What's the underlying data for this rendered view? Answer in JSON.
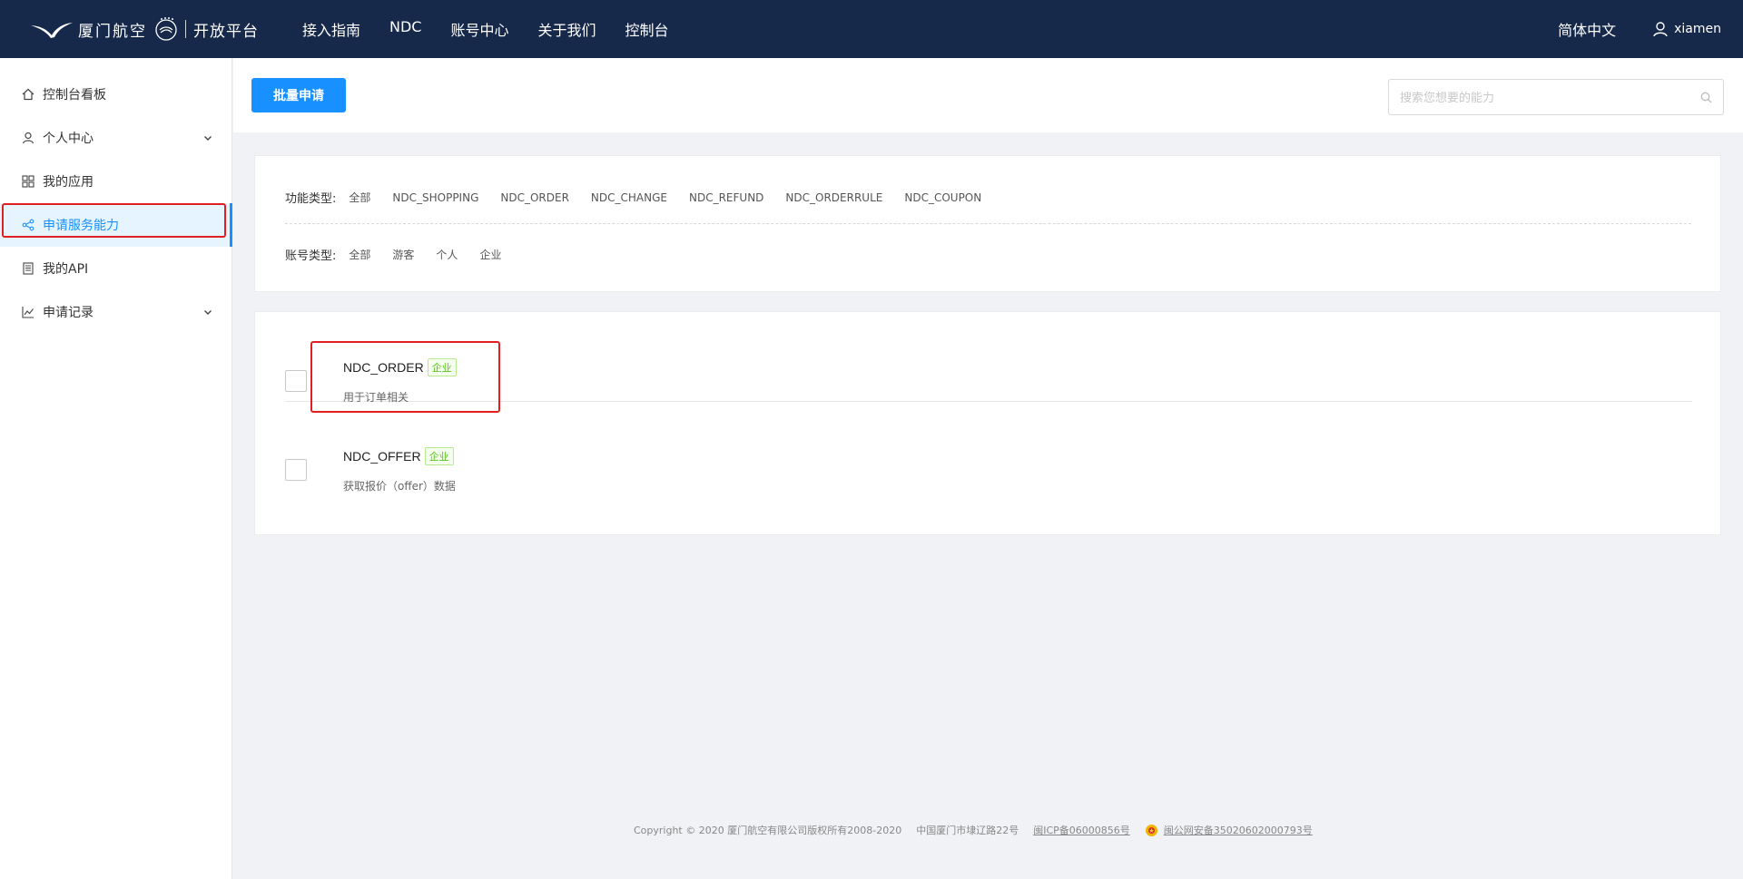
{
  "header": {
    "logo_cn": "厦门航空",
    "logo_platform": "开放平台",
    "nav": [
      "接入指南",
      "NDC",
      "账号中心",
      "关于我们",
      "控制台"
    ],
    "language": "简体中文",
    "username": "xiamen",
    "bg_color": "#17294a"
  },
  "sidebar": {
    "items": [
      {
        "label": "控制台看板",
        "icon": "home-icon"
      },
      {
        "label": "个人中心",
        "icon": "user-icon"
      },
      {
        "label": "我的应用",
        "icon": "apps-grid-icon"
      },
      {
        "label": "申请服务能力",
        "icon": "share-icon"
      },
      {
        "label": "我的API",
        "icon": "document-icon"
      },
      {
        "label": "申请记录",
        "icon": "chart-line-icon"
      }
    ],
    "active_index": 3,
    "accent": "#1890ff"
  },
  "toolbar": {
    "batch_button": "批量申请",
    "search_placeholder": "搜索您想要的能力"
  },
  "filters": {
    "func_label": "功能类型:",
    "func_options": [
      "全部",
      "NDC_SHOPPING",
      "NDC_ORDER",
      "NDC_CHANGE",
      "NDC_REFUND",
      "NDC_ORDERRULE",
      "NDC_COUPON"
    ],
    "account_label": "账号类型:",
    "account_options": [
      "全部",
      "游客",
      "个人",
      "企业"
    ]
  },
  "list": {
    "items": [
      {
        "title": "NDC_ORDER",
        "tag": "企业",
        "desc": "用于订单相关"
      },
      {
        "title": "NDC_OFFER",
        "tag": "企业",
        "desc": "获取报价（offer）数据"
      }
    ]
  },
  "footer": {
    "copyright": "Copyright © 2020 厦门航空有限公司版权所有2008-2020",
    "address": "中国厦门市埭辽路22号",
    "icp": "闽ICP备06000856号",
    "police": "闽公网安备35020602000793号"
  }
}
